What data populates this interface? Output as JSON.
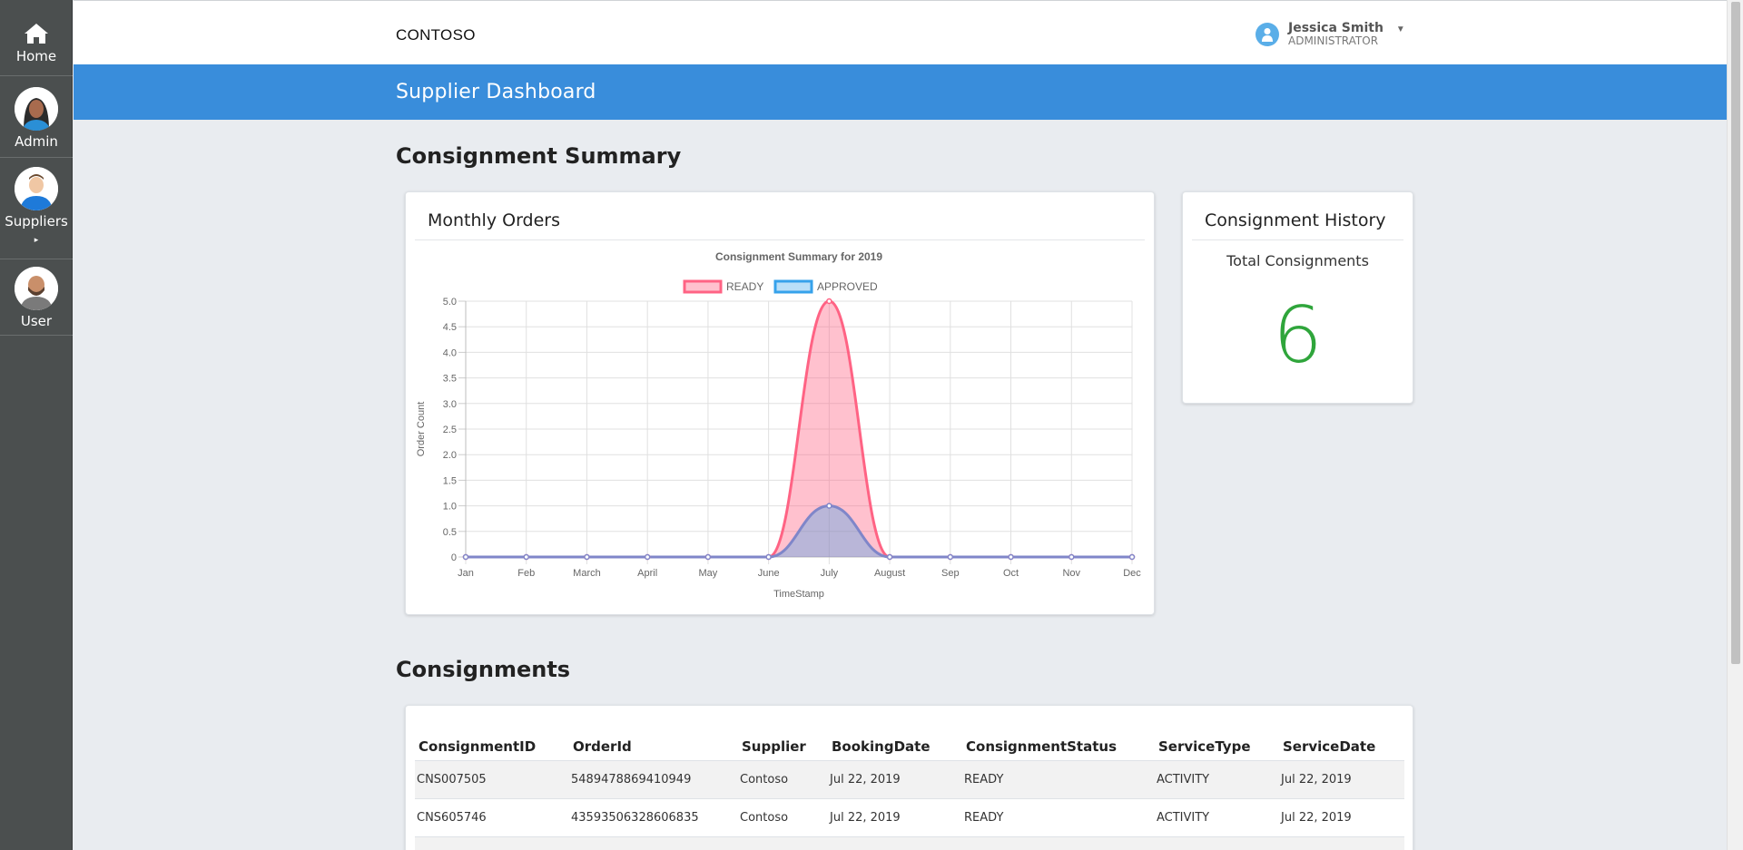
{
  "nav": {
    "items": [
      {
        "label": "Home",
        "icon": "home-icon"
      },
      {
        "label": "Admin",
        "icon": "admin-avatar"
      },
      {
        "label": "Suppliers",
        "icon": "suppliers-avatar"
      },
      {
        "label": "User",
        "icon": "user-avatar"
      }
    ],
    "suppliers_arrow": "▸"
  },
  "header": {
    "brand": "CONTOSO",
    "user_name": "Jessica Smith",
    "user_role": "ADMINISTRATOR",
    "caret": "▼"
  },
  "band": {
    "title": "Supplier Dashboard"
  },
  "summary": {
    "section_title": "Consignment Summary",
    "chart_card_title": "Monthly Orders",
    "history_card_title": "Consignment History",
    "history_label": "Total Consignments",
    "history_value": "6"
  },
  "chart_data": {
    "type": "area",
    "title": "Consignment Summary for 2019",
    "xlabel": "TimeStamp",
    "ylabel": "Order Count",
    "categories": [
      "Jan",
      "Feb",
      "March",
      "April",
      "May",
      "June",
      "July",
      "August",
      "Sep",
      "Oct",
      "Nov",
      "Dec"
    ],
    "ylim": [
      0,
      5.0
    ],
    "yticks": [
      "0",
      "0.5",
      "1.0",
      "1.5",
      "2.0",
      "2.5",
      "3.0",
      "3.5",
      "4.0",
      "4.5",
      "5.0"
    ],
    "grid": true,
    "legend_placement": "top-center",
    "series": [
      {
        "name": "READY",
        "values": [
          0,
          0,
          0,
          0,
          0,
          0,
          5,
          0,
          0,
          0,
          0,
          0
        ],
        "color": "#ff6384",
        "fill": "rgba(255,99,132,0.4)"
      },
      {
        "name": "APPROVED",
        "values": [
          0,
          0,
          0,
          0,
          0,
          0,
          1,
          0,
          0,
          0,
          0,
          0
        ],
        "color": "#36a2eb",
        "fill": "rgba(54,162,235,0.35)"
      }
    ]
  },
  "consignments": {
    "section_title": "Consignments",
    "columns": [
      "ConsignmentID",
      "OrderId",
      "Supplier",
      "BookingDate",
      "ConsignmentStatus",
      "ServiceType",
      "ServiceDate"
    ],
    "rows": [
      [
        "CNS007505",
        "5489478869410949",
        "Contoso",
        "Jul 22, 2019",
        "READY",
        "ACTIVITY",
        "Jul 22, 2019"
      ],
      [
        "CNS605746",
        "43593506328606835",
        "Contoso",
        "Jul 22, 2019",
        "READY",
        "ACTIVITY",
        "Jul 22, 2019"
      ]
    ]
  }
}
